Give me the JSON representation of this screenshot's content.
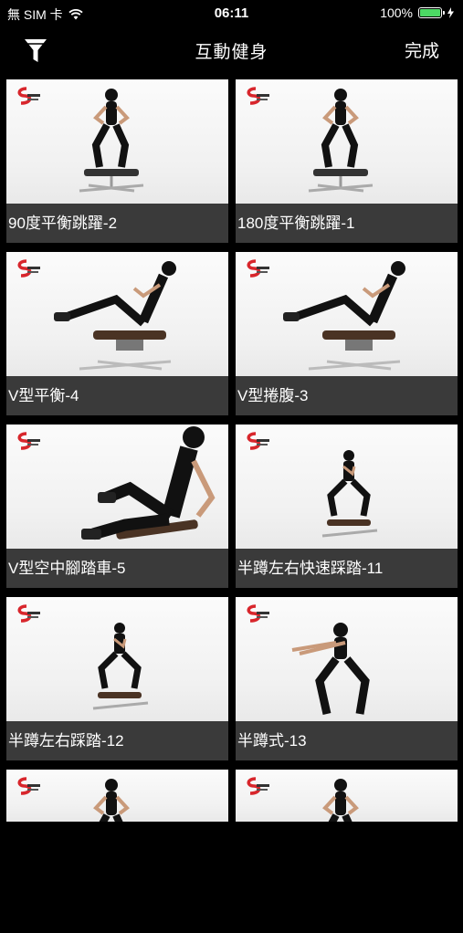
{
  "status": {
    "carrier": "無 SIM 卡",
    "time": "06:11",
    "battery": "100%",
    "battery_level": 1.0
  },
  "nav": {
    "title": "互動健身",
    "done_label": "完成"
  },
  "exercises": [
    {
      "title": "90度平衡跳躍-2",
      "pose": "stand"
    },
    {
      "title": "180度平衡跳躍-1",
      "pose": "stand"
    },
    {
      "title": "V型平衡-4",
      "pose": "vsit"
    },
    {
      "title": "V型捲腹-3",
      "pose": "vsit"
    },
    {
      "title": "V型空中腳踏車-5",
      "pose": "closeup"
    },
    {
      "title": "半蹲左右快速踩踏-11",
      "pose": "squat"
    },
    {
      "title": "半蹲左右踩踏-12",
      "pose": "squat"
    },
    {
      "title": "半蹲式-13",
      "pose": "squatfloor"
    },
    {
      "title": "",
      "pose": "stand"
    },
    {
      "title": "",
      "pose": "stand"
    }
  ],
  "colors": {
    "background": "#000000",
    "caption_bg": "#3a3a3a",
    "battery": "#4cd964",
    "brand": "#d8262c"
  }
}
